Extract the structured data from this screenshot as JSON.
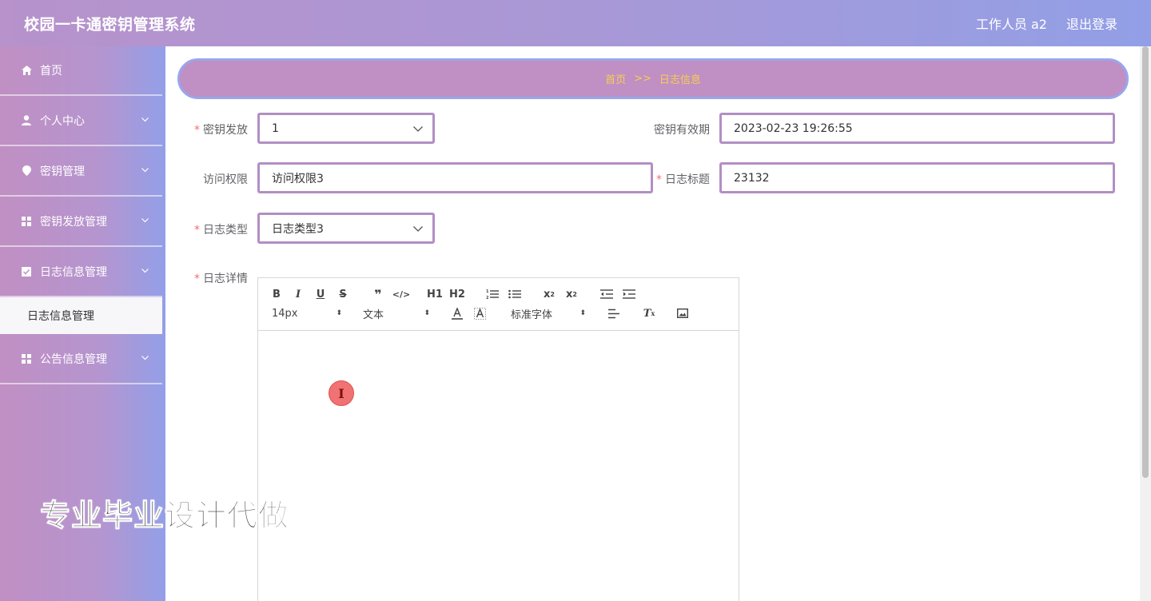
{
  "header": {
    "title": "校园一卡通密钥管理系统",
    "user_label": "工作人员 a2",
    "logout_label": "退出登录"
  },
  "sidebar": {
    "items": [
      {
        "label": "首页",
        "icon": "home-icon"
      },
      {
        "label": "个人中心",
        "icon": "user-icon"
      },
      {
        "label": "密钥管理",
        "icon": "location-icon"
      },
      {
        "label": "密钥发放管理",
        "icon": "grid-icon"
      },
      {
        "label": "日志信息管理",
        "icon": "checkbox-icon"
      },
      {
        "label": "公告信息管理",
        "icon": "grid-icon"
      }
    ],
    "submenu_label": "日志信息管理"
  },
  "breadcrumb": {
    "home": "首页",
    "separator": ">>",
    "current": "日志信息"
  },
  "form": {
    "key_issue": {
      "label": "密钥发放",
      "value": "1"
    },
    "key_validity": {
      "label": "密钥有效期",
      "value": "2023-02-23 19:26:55"
    },
    "access": {
      "label": "访问权限",
      "value": "访问权限3"
    },
    "log_title": {
      "label": "日志标题",
      "value": "23132"
    },
    "log_type": {
      "label": "日志类型",
      "value": "日志类型3"
    },
    "log_detail": {
      "label": "日志详情"
    },
    "required_mark": "*"
  },
  "editor": {
    "font_size": "14px",
    "header_select": "文本",
    "font_family": "标准字体",
    "h1": "H1",
    "h2": "H2"
  },
  "watermark": "专业毕业设计代做",
  "colors": {
    "accent_purple": "#c08fc3",
    "accent_blue": "#939fe8",
    "breadcrumb_text": "#f7cf52",
    "required": "#f56c6c"
  }
}
